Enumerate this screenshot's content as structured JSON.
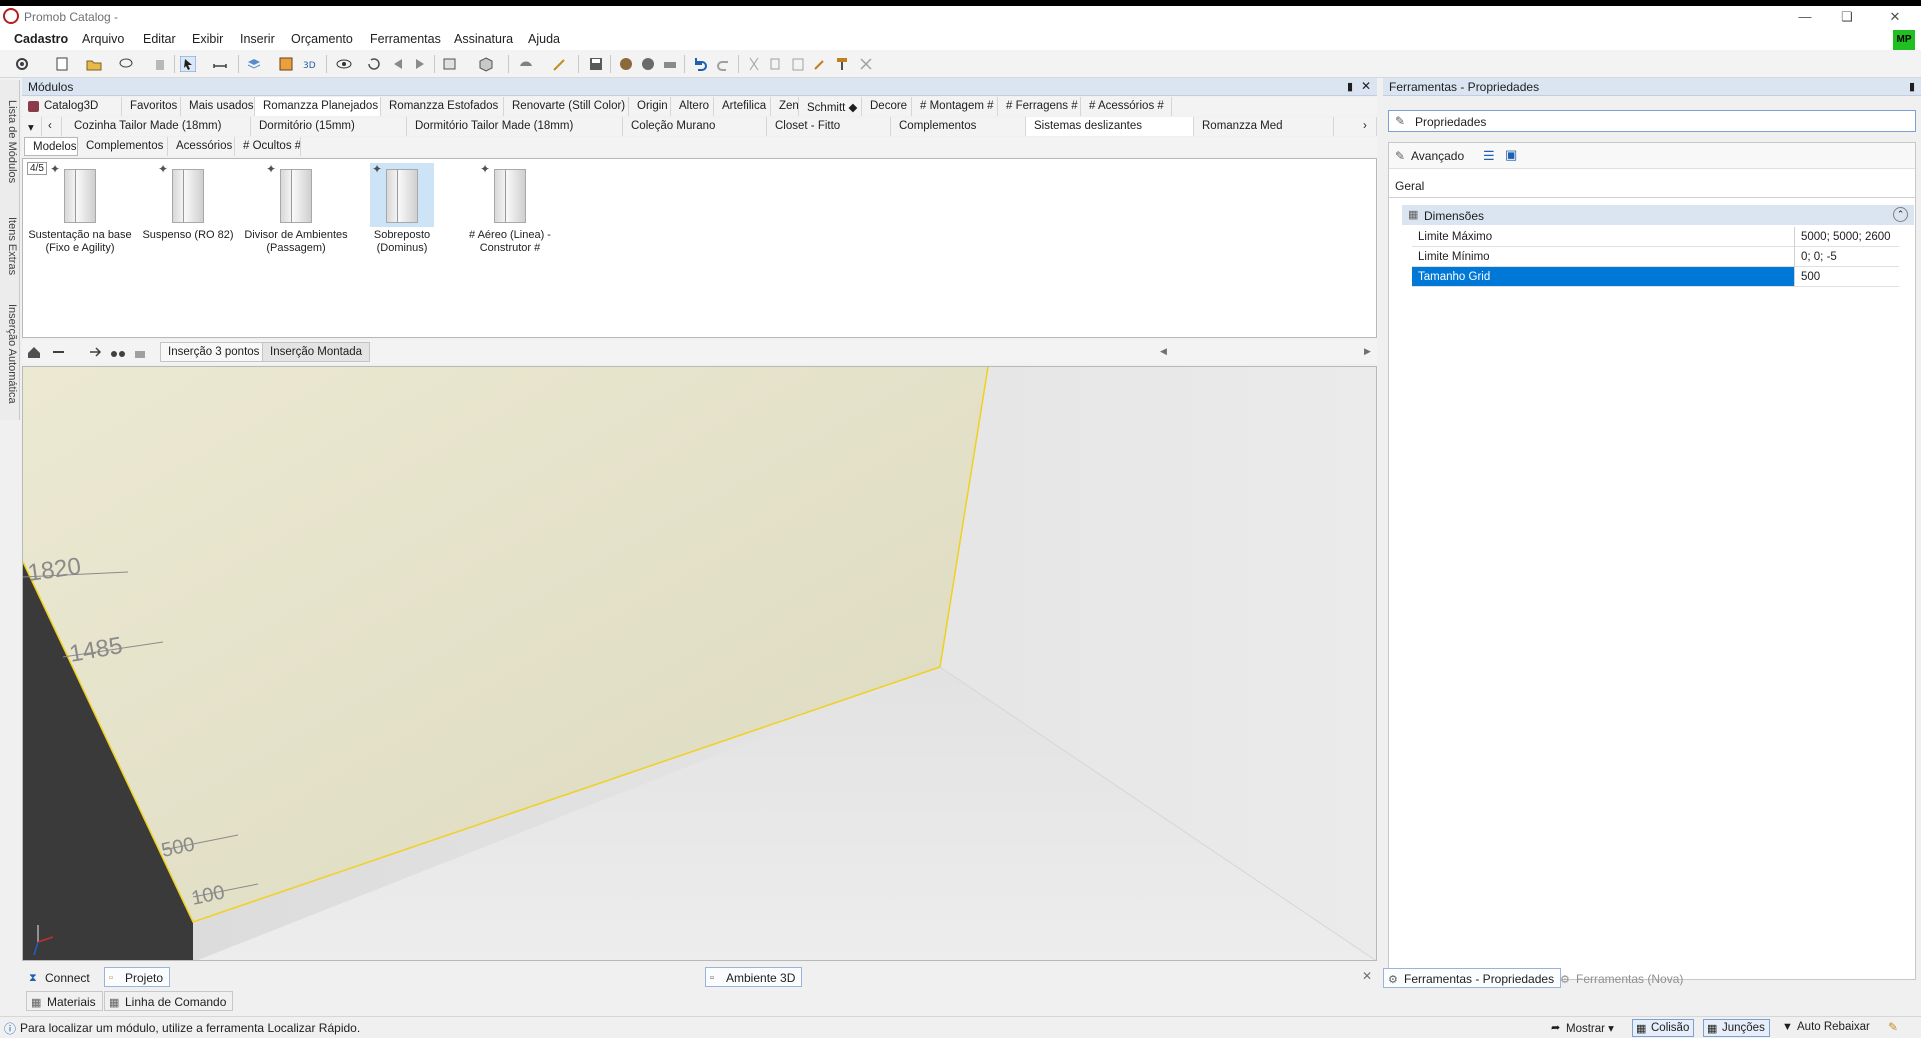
{
  "window": {
    "title": "Promob Catalog -"
  },
  "menu": [
    "Cadastro",
    "Arquivo",
    "Editar",
    "Exibir",
    "Inserir",
    "Orçamento",
    "Ferramentas",
    "Assinatura",
    "Ajuda"
  ],
  "user": {
    "initials": "MP"
  },
  "side_tabs": [
    "Lista de Módulos",
    "Itens Extras",
    "Inserção Automática"
  ],
  "modules_panel": {
    "title": "Módulos",
    "catalog_tabs": [
      "Catalog3D",
      "Favoritos",
      "Mais usados",
      "Romanzza Planejados",
      "Romanzza Estofados",
      "Renovarte (Still Color)",
      "Origin",
      "Altero",
      "Artefilica",
      "Zen",
      "Schmitt ◆",
      "Decore",
      "# Montagem #",
      "# Ferragens #",
      "# Acessórios #"
    ],
    "line_tabs": [
      "Cozinha Tailor Made (18mm)",
      "Dormitório (15mm)",
      "Dormitório Tailor Made (18mm)",
      "Coleção Murano",
      "Closet - Fitto",
      "Complementos",
      "Sistemas deslizantes",
      "Romanzza Med"
    ],
    "group_tabs": [
      "Modelos",
      "Complementos",
      "Acessórios",
      "# Ocultos #"
    ],
    "counter": "4/5",
    "items": [
      {
        "label": "Sustentação na base (Fixo e Agility)"
      },
      {
        "label": "Suspenso (RO 82)"
      },
      {
        "label": "Divisor de Ambientes (Passagem)"
      },
      {
        "label": "Sobreposto (Dominus)"
      },
      {
        "label": "# Aéreo (Linea) - Construtor #"
      }
    ]
  },
  "view_toolbar": {
    "insert_3pts": "Inserção 3 pontos",
    "insert_mounted": "Inserção Montada"
  },
  "viewport": {
    "dim_labels": [
      "1820",
      "1485",
      "500",
      "100"
    ]
  },
  "bottom_tabs": {
    "connect": "Connect",
    "projeto": "Projeto",
    "ambiente": "Ambiente 3D",
    "materiais": "Materiais",
    "linha": "Linha de Comando"
  },
  "status": {
    "message": "Para localizar um módulo, utilize a ferramenta Localizar Rápido.",
    "mostrar": "Mostrar",
    "colisao": "Colisão",
    "juncoes": "Junções",
    "auto_rebaixar": "Auto Rebaixar"
  },
  "right_panel": {
    "title": "Ferramentas - Propriedades",
    "propriedades": "Propriedades",
    "avancado": "Avançado",
    "geral_tab": "Geral",
    "section": "Dimensões",
    "rows": [
      {
        "key": "Limite Máximo",
        "value": "5000; 5000; 2600"
      },
      {
        "key": "Limite Mínimo",
        "value": "0; 0; -5"
      },
      {
        "key": "Tamanho Grid",
        "value": "500"
      }
    ],
    "footer_tabs": [
      "Ferramentas - Propriedades",
      "Ferramentas (Nova)"
    ]
  }
}
